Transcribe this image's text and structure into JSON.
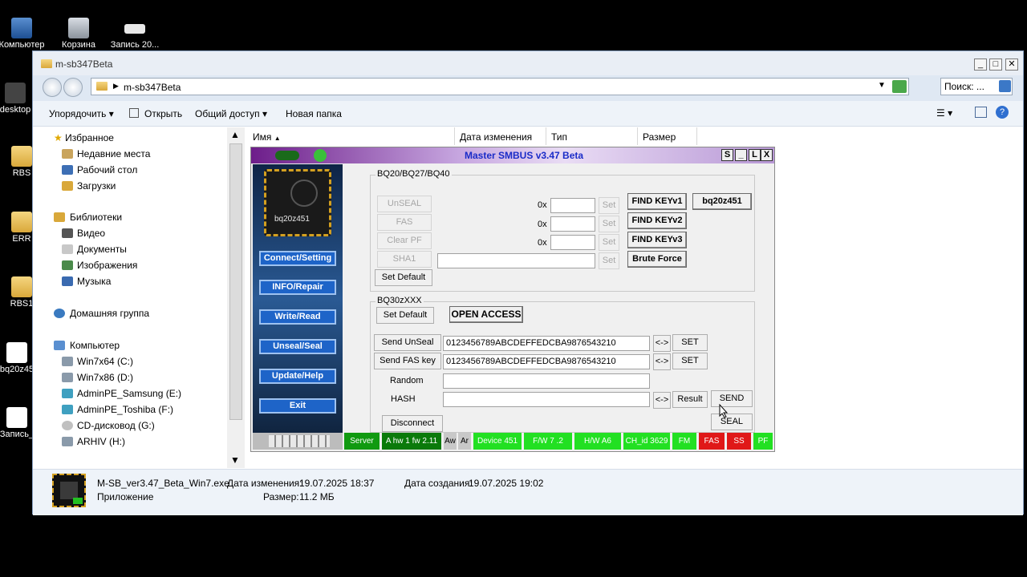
{
  "desktop": {
    "icons": [
      {
        "label": "Компьютер",
        "icon": "computer-icon"
      },
      {
        "label": "Корзина",
        "icon": "recycle-bin-icon"
      },
      {
        "label": "Запись 20...",
        "icon": "file-icon"
      },
      {
        "label": "desktop",
        "icon": "file-icon"
      },
      {
        "label": "RBS",
        "icon": "folder-icon"
      },
      {
        "label": "ERR",
        "icon": "folder-icon"
      },
      {
        "label": "RBS1",
        "icon": "folder-icon"
      },
      {
        "label": "bq20z45",
        "icon": "document-icon"
      },
      {
        "label": "Запись_",
        "icon": "document-icon"
      }
    ]
  },
  "explorer": {
    "title": "m-sb347Beta",
    "address": "m-sb347Beta",
    "search_placeholder": "Поиск: ...",
    "toolbar": {
      "organize": "Упорядочить",
      "open": "Открыть",
      "share": "Общий доступ",
      "new_folder": "Новая папка"
    },
    "columns": [
      "Имя",
      "Дата изменения",
      "Тип",
      "Размер"
    ],
    "nav": {
      "favorites": "Избранное",
      "recent": "Недавние места",
      "desktop": "Рабочий стол",
      "downloads": "Загрузки",
      "libraries": "Библиотеки",
      "video": "Видео",
      "documents": "Документы",
      "images": "Изображения",
      "music": "Музыка",
      "homegroup": "Домашняя группа",
      "computer": "Компьютер",
      "drive_c": "Win7x64 (C:)",
      "drive_d": "Win7x86 (D:)",
      "drive_e": "AdminPE_Samsung (E:)",
      "drive_f": "AdminPE_Toshiba (F:)",
      "drive_g": "CD-дисковод (G:)",
      "drive_h": "ARHIV (H:)"
    },
    "details": {
      "filename": "M-SB_ver3.47_Beta_Win7.exe",
      "type": "Приложение",
      "modified_label": "Дата изменения:",
      "modified": "19.07.2025 18:37",
      "size_label": "Размер:",
      "size": "11.2 МБ",
      "created_label": "Дата создания:",
      "created": "19.07.2025 19:02"
    }
  },
  "app": {
    "title": "Master SMBUS v3.47 Beta",
    "window_buttons": [
      "S",
      "_",
      "L",
      "X"
    ],
    "chip_label": "bq20z451",
    "side_buttons": [
      "Connect/Setting",
      "INFO/Repair",
      "Write/Read",
      "Unseal/Seal",
      "Update/Help",
      "Exit"
    ],
    "group1": {
      "title": "BQ20/BQ27/BQ40",
      "unseal": "UnSEAL",
      "fas": "FAS",
      "clear_pf": "Clear PF",
      "sha1": "SHA1",
      "set_default": "Set Default",
      "hex_prefix": "0x",
      "set": "Set",
      "find_key_v1": "FIND KEYv1",
      "find_key_v2": "FIND KEYv2",
      "find_key_v3": "FIND KEYv3",
      "brute_force": "Brute Force",
      "chip_button": "bq20z451"
    },
    "group2": {
      "title": "BQ30zXXX",
      "set_default": "Set Default",
      "open_access": "OPEN ACCESS",
      "send_unseal_key": "Send UnSeal key",
      "send_fas_key": "Send FAS key",
      "unseal_key_value": "0123456789ABCDEFFEDCBA9876543210",
      "fas_key_value": "0123456789ABCDEFFEDCBA9876543210",
      "random": "Random",
      "hash": "HASH",
      "swap": "<->",
      "set": "SET",
      "result": "Result",
      "send": "SEND",
      "seal": "SEAL",
      "disconnect": "Disconnect"
    },
    "status": [
      {
        "text": "Server",
        "color": "#109a10"
      },
      {
        "text": "A hw 1 fw 2.11",
        "color": "#0a7a0a"
      },
      {
        "text": "Aw",
        "color": "#c8c8c8"
      },
      {
        "text": "Ar",
        "color": "#c8c8c8"
      },
      {
        "text": "Device 451",
        "color": "#22e022"
      },
      {
        "text": "F/W 7 .2",
        "color": "#22e022"
      },
      {
        "text": "H/W A6",
        "color": "#22e022"
      },
      {
        "text": "CH_id 3629",
        "color": "#22e022"
      },
      {
        "text": "FM",
        "color": "#22e022"
      },
      {
        "text": "FAS",
        "color": "#e01818"
      },
      {
        "text": "SS",
        "color": "#e01818"
      },
      {
        "text": "PF",
        "color": "#22e022"
      }
    ]
  }
}
